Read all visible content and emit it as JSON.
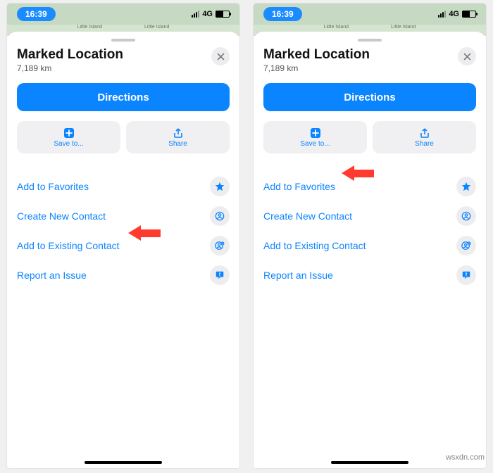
{
  "statusbar": {
    "time": "16:39",
    "network": "4G"
  },
  "map": {
    "label1": "Little Island",
    "label2": "Little Island"
  },
  "sheet": {
    "title": "Marked Location",
    "subtitle": "7,189 km",
    "directions": "Directions",
    "save": "Save to...",
    "share": "Share"
  },
  "rows": {
    "favorites": "Add to Favorites",
    "newContact": "Create New Contact",
    "existingContact": "Add to Existing Contact",
    "report": "Report an Issue"
  },
  "watermark": "wsxdn.com"
}
